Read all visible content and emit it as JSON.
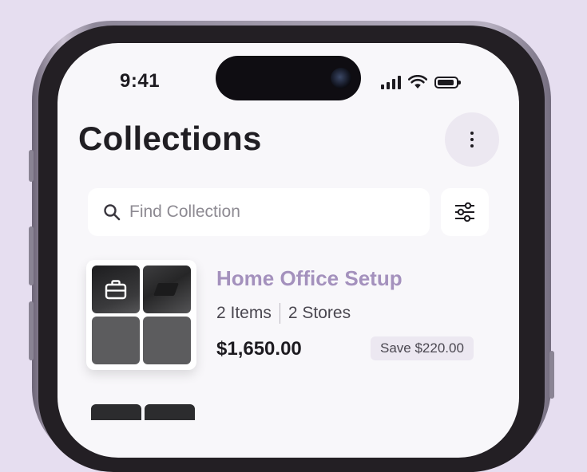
{
  "status_bar": {
    "time": "9:41",
    "icons": [
      "cellular-signal-icon",
      "wifi-icon",
      "battery-icon"
    ]
  },
  "header": {
    "title": "Collections",
    "menu_icon": "more-vertical-icon"
  },
  "search": {
    "placeholder": "Find Collection",
    "value": "",
    "icon": "search-icon",
    "filter_icon": "sliders-icon"
  },
  "collections": [
    {
      "name": "Home Office Setup",
      "items": "2 Items",
      "stores": "2 Stores",
      "price": "$1,650.00",
      "savings": "Save $220.00",
      "thumbnail_icon": "briefcase-icon"
    }
  ],
  "colors": {
    "background": "#e6def0",
    "screen": "#f8f7fa",
    "accent": "#a491bd",
    "badge_bg": "#ece8f1",
    "text_primary": "#1d1b20"
  }
}
